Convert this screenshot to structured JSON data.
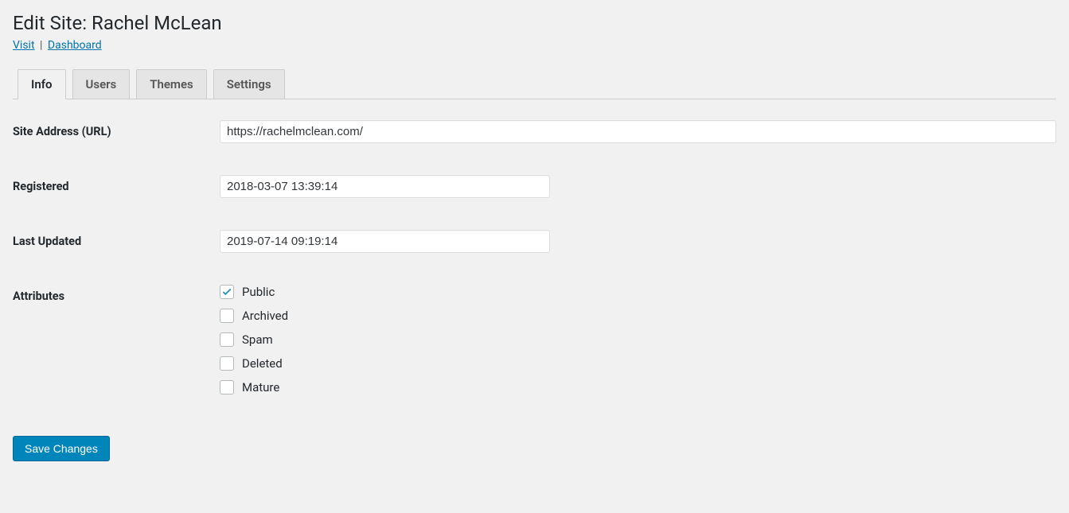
{
  "header": {
    "title": "Edit Site: Rachel McLean",
    "links": {
      "visit": "Visit",
      "dashboard": "Dashboard"
    }
  },
  "tabs": {
    "info": "Info",
    "users": "Users",
    "themes": "Themes",
    "settings": "Settings"
  },
  "form": {
    "site_url_label": "Site Address (URL)",
    "site_url_value": "https://rachelmclean.com/",
    "registered_label": "Registered",
    "registered_value": "2018-03-07 13:39:14",
    "updated_label": "Last Updated",
    "updated_value": "2019-07-14 09:19:14",
    "attributes_label": "Attributes",
    "attributes": {
      "public": "Public",
      "archived": "Archived",
      "spam": "Spam",
      "deleted": "Deleted",
      "mature": "Mature"
    }
  },
  "actions": {
    "save": "Save Changes"
  }
}
